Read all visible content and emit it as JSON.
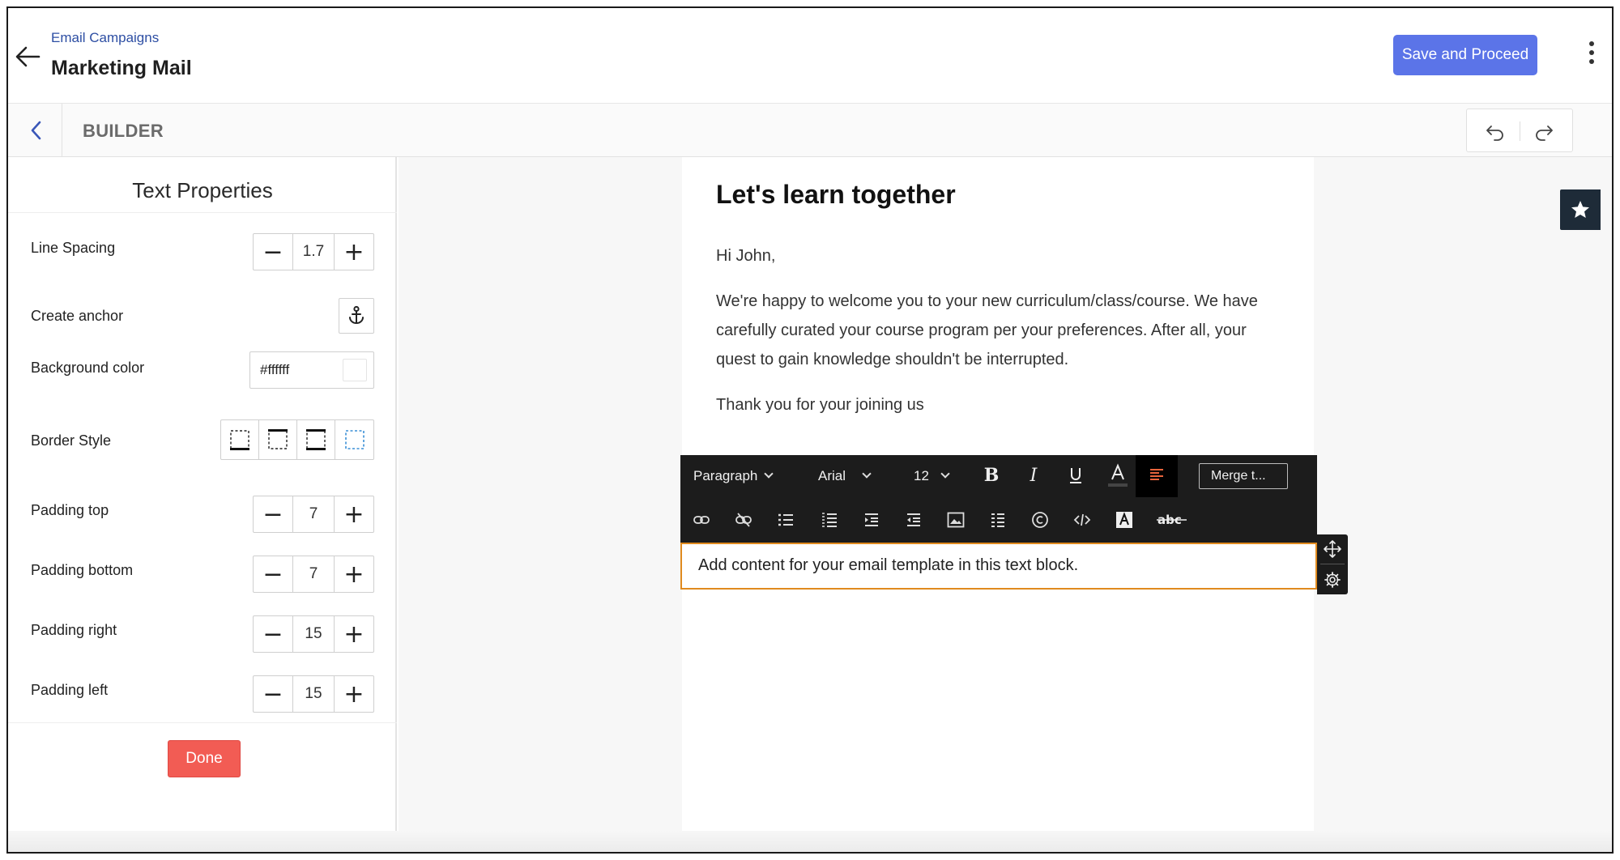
{
  "header": {
    "breadcrumb": "Email Campaigns",
    "title": "Marketing Mail",
    "save_label": "Save and Proceed"
  },
  "builder": {
    "title": "BUILDER"
  },
  "panel": {
    "title": "Text Properties",
    "line_spacing": {
      "label": "Line Spacing",
      "value": "1.7"
    },
    "anchor": {
      "label": "Create anchor"
    },
    "background": {
      "label": "Background color",
      "value": "#ffffff"
    },
    "border": {
      "label": "Border Style"
    },
    "padding_top": {
      "label": "Padding top",
      "value": "7"
    },
    "padding_bottom": {
      "label": "Padding bottom",
      "value": "7"
    },
    "padding_right": {
      "label": "Padding right",
      "value": "15"
    },
    "padding_left": {
      "label": "Padding left",
      "value": "15"
    },
    "done_label": "Done"
  },
  "email": {
    "heading": "Let's learn together",
    "greeting": "Hi John,",
    "body": "We're happy to welcome you to your new curriculum/class/course. We have carefully curated your course program per your preferences. After all, your quest to gain knowledge shouldn't be interrupted.",
    "closing": "Thank you for your joining us",
    "text_block": "Add content for your email template in this text block."
  },
  "toolbar": {
    "paragraph": "Paragraph",
    "font": "Arial",
    "size": "12",
    "merge": "Merge t..."
  },
  "colors": {
    "accent": "#5b74e8",
    "done": "#f25c54",
    "selection": "#e08a1e",
    "toolbar_bg": "#1c1c1c"
  }
}
